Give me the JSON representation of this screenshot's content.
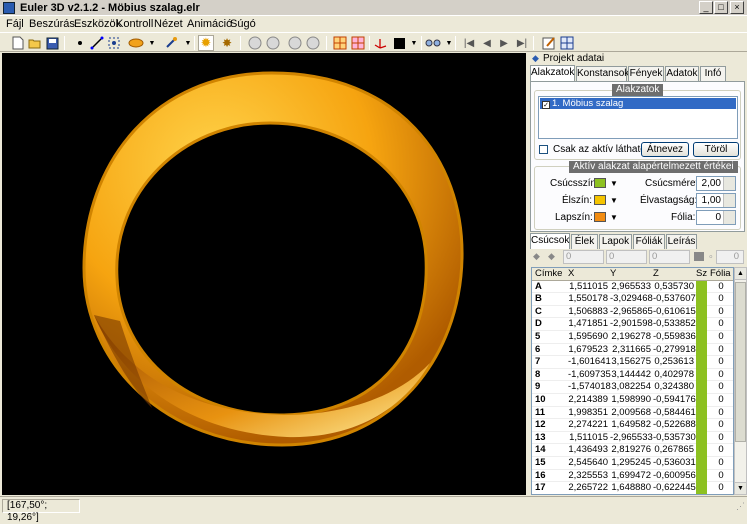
{
  "window": {
    "title": "Euler 3D v2.1.2 - Möbius szalag.elr",
    "minimize": "_",
    "maximize": "□",
    "close": "×"
  },
  "menu": [
    "Fájl",
    "Beszúrás",
    "Eszközök",
    "Kontroll",
    "Nézet",
    "Animáció",
    "Súgó"
  ],
  "toolbar_icons": [
    "new-icon",
    "open-icon",
    "save-icon",
    "point-icon",
    "line-icon",
    "select-icon",
    "paint-icon",
    "rotate-icon",
    "star-icon",
    "tool-icon",
    "circle-icon",
    "circle2-icon",
    "circle3-icon",
    "circle4-icon",
    "grid-icon",
    "grid2-icon",
    "axis-icon",
    "color-icon",
    "glasses-icon",
    "first-icon",
    "prev-icon",
    "play-icon",
    "last-icon",
    "edit-icon",
    "window-icon"
  ],
  "status": {
    "coords": "[167,50°; 19,26°]"
  },
  "panel": {
    "header": "Projekt adatai",
    "tabs": [
      "Alakzatok",
      "Konstansok",
      "Fények",
      "Adatok",
      "Infó"
    ],
    "shapes_group": "Alakzatok",
    "shapes": [
      "1. Möbius szalag"
    ],
    "only_active": "Csak az aktív látható",
    "rename": "Átnevez",
    "delete": "Töröl",
    "defaults_group": "Aktív alakzat alapértelmezett értékei",
    "vertex_color": "Csúcsszín:",
    "edge_color": "Élszín:",
    "face_color": "Lapszín:",
    "vertex_size": "Csúcsméret:",
    "vertex_size_val": "2,00",
    "edge_width": "Élvastagság:",
    "edge_width_val": "1,00",
    "foil": "Fólia:",
    "foil_val": "0",
    "colors": {
      "vertex": "#8dc121",
      "edge": "#f5c400",
      "face": "#f28c12"
    }
  },
  "data": {
    "tabs": [
      "Csúcsok",
      "Élek",
      "Lapok",
      "Fóliák",
      "Leírás"
    ],
    "inputs": [
      "0",
      "0",
      "0",
      "0"
    ],
    "columns": [
      "Címke",
      "X",
      "Y",
      "Z",
      "Sz",
      "Fólia"
    ],
    "rows": [
      [
        "A",
        "1,511015",
        "2,965533",
        "0,535730",
        "0"
      ],
      [
        "B",
        "1,550178",
        "-3,029468",
        "-0,537607",
        "0"
      ],
      [
        "C",
        "1,506883",
        "-2,965865",
        "-0,610615",
        "0"
      ],
      [
        "D",
        "1,471851",
        "-2,901598",
        "-0,533852",
        "0"
      ],
      [
        "5",
        "1,595690",
        "2,196278",
        "-0,559836",
        "0"
      ],
      [
        "6",
        "1,679523",
        "2,311665",
        "-0,279918",
        "0"
      ],
      [
        "7",
        "-1,601641",
        "3,156275",
        "0,253613",
        "0"
      ],
      [
        "8",
        "-1,609735",
        "3,144442",
        "0,402978",
        "0"
      ],
      [
        "9",
        "-1,574018",
        "3,082254",
        "0,324380",
        "0"
      ],
      [
        "10",
        "2,214389",
        "1,598990",
        "-0,594176",
        "0"
      ],
      [
        "11",
        "1,998351",
        "2,009568",
        "-0,584461",
        "0"
      ],
      [
        "12",
        "2,274221",
        "1,649582",
        "-0,522688",
        "0"
      ],
      [
        "13",
        "1,511015",
        "-2,965533",
        "-0,535730",
        "0"
      ],
      [
        "14",
        "1,436493",
        "2,819276",
        "0,267865",
        "0"
      ],
      [
        "15",
        "2,545640",
        "1,295245",
        "-0,536031",
        "0"
      ],
      [
        "16",
        "2,325553",
        "1,699472",
        "-0,600956",
        "0"
      ],
      [
        "17",
        "2,265722",
        "1,648880",
        "-0,622445",
        "0"
      ]
    ]
  }
}
